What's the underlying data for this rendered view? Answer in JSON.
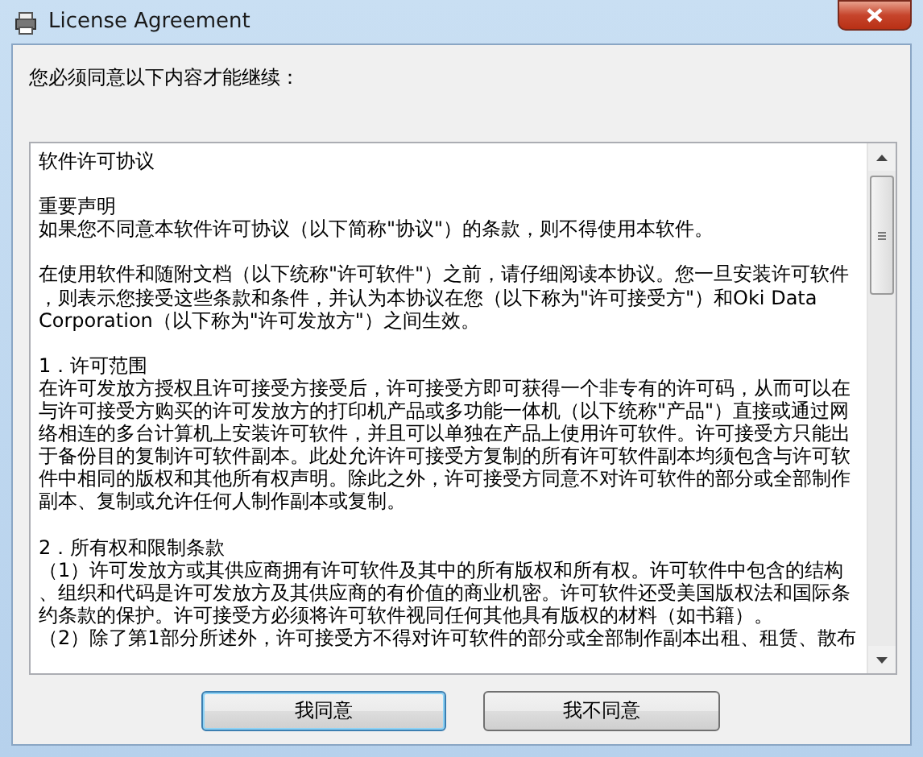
{
  "window": {
    "title": "License Agreement"
  },
  "instruction": "您必须同意以下内容才能继续：",
  "license_paragraphs": [
    {
      "lines": [
        "软件许可协议"
      ]
    },
    {
      "lines": [
        "重要声明",
        "如果您不同意本软件许可协议（以下简称\"协议\"）的条款，则不得使用本软件。"
      ]
    },
    {
      "lines": [
        "在使用软件和随附文档（以下统称\"许可软件\"）之前，请仔细阅读本协议。您一旦安装许可软件",
        "，则表示您接受这些条款和条件，并认为本协议在您（以下称为\"许可接受方\"）和Oki Data",
        "Corporation（以下称为\"许可发放方\"）之间生效。"
      ]
    },
    {
      "lines": [
        "1．许可范围",
        "在许可发放方授权且许可接受方接受后，许可接受方即可获得一个非专有的许可码，从而可以在",
        "与许可接受方购买的许可发放方的打印机产品或多功能一体机（以下统称\"产品\"）直接或通过网",
        "络相连的多台计算机上安装许可软件，并且可以单独在产品上使用许可软件。许可接受方只能出",
        "于备份目的复制许可软件副本。此处允许许可接受方复制的所有许可软件副本均须包含与许可软",
        "件中相同的版权和其他所有权声明。除此之外，许可接受方同意不对许可软件的部分或全部制作",
        "副本、复制或允许任何人制作副本或复制。"
      ]
    },
    {
      "lines": [
        "2．所有权和限制条款",
        "（1）许可发放方或其供应商拥有许可软件及其中的所有版权和所有权。许可软件中包含的结构",
        "、组织和代码是许可发放方及其供应商的有价值的商业机密。许可软件还受美国版权法和国际条",
        "约条款的保护。许可接受方必须将许可软件视同任何其他具有版权的材料（如书籍）。",
        "（2）除了第1部分所述外，许可接受方不得对许可软件的部分或全部制作副本出租、租赁、散布"
      ]
    }
  ],
  "buttons": [
    {
      "label": "我同意",
      "kind": "default"
    },
    {
      "label": "我不同意",
      "kind": "normal"
    }
  ]
}
